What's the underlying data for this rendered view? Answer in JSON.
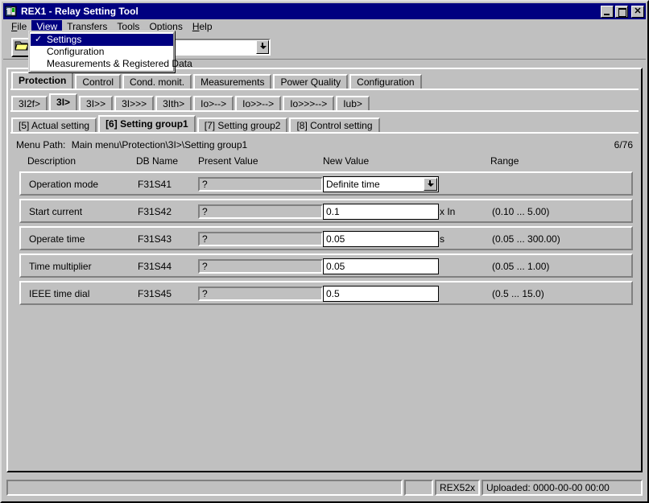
{
  "window": {
    "title": "REX1 - Relay Setting Tool",
    "icon": "relay-device-icon",
    "buttons": {
      "minimize": "_",
      "maximize": "□",
      "close": "✕"
    },
    "colors": {
      "titlebar": "#000080",
      "face": "#c0c0c0",
      "highlight": "#ffffff",
      "shadow": "#808080",
      "menu_highlight": "#000080"
    }
  },
  "menubar": {
    "items": [
      {
        "label": "File",
        "accel": "F",
        "open": false
      },
      {
        "label": "View",
        "accel": "V",
        "open": true
      },
      {
        "label": "Transfers",
        "accel": "T",
        "open": false
      },
      {
        "label": "Tools",
        "accel": "T",
        "open": false
      },
      {
        "label": "Options",
        "accel": "O",
        "open": false
      },
      {
        "label": "Help",
        "accel": "H",
        "open": false
      }
    ]
  },
  "dropdown": {
    "owner": "View",
    "items": [
      {
        "label": "Settings",
        "checked": true,
        "selected": true
      },
      {
        "label": "Configuration",
        "checked": false,
        "selected": false
      },
      {
        "label": "Measurements & Registered Data",
        "checked": false,
        "selected": false
      }
    ]
  },
  "toolbar": {
    "open_button_icon": "open-folder-icon",
    "combo_value": "",
    "combo_placeholder": "",
    "combo_arrow_icon": "dropdown-arrow-icon"
  },
  "tabs_primary": [
    {
      "label": "Protection",
      "active": true
    },
    {
      "label": "Control",
      "active": false
    },
    {
      "label": "Cond. monit.",
      "active": false
    },
    {
      "label": "Measurements",
      "active": false
    },
    {
      "label": "Power Quality",
      "active": false
    },
    {
      "label": "Configuration",
      "active": false
    }
  ],
  "tabs_secondary": [
    {
      "label": "3I2f>",
      "active": false
    },
    {
      "label": "3I>",
      "active": true
    },
    {
      "label": "3I>>",
      "active": false
    },
    {
      "label": "3I>>>",
      "active": false
    },
    {
      "label": "3Ith>",
      "active": false
    },
    {
      "label": "Io>-->",
      "active": false
    },
    {
      "label": "Io>>-->",
      "active": false
    },
    {
      "label": "Io>>>-->",
      "active": false
    },
    {
      "label": "Iub>",
      "active": false
    }
  ],
  "tabs_tertiary": [
    {
      "label": "[5] Actual setting",
      "active": false
    },
    {
      "label": "[6] Setting group1",
      "active": true
    },
    {
      "label": "[7] Setting group2",
      "active": false
    },
    {
      "label": "[8] Control setting",
      "active": false
    }
  ],
  "menu_path": {
    "label": "Menu Path:",
    "value": "Main menu\\Protection\\3I>\\Setting group1",
    "counter": "6/76"
  },
  "columns": {
    "description": "Description",
    "db_name": "DB Name",
    "present_value": "Present Value",
    "new_value": "New Value",
    "range": "Range"
  },
  "rows": [
    {
      "description": "Operation mode",
      "db_name": "F31S41",
      "present_value": "?",
      "new_value": "Definite time",
      "new_value_type": "combo",
      "unit": "",
      "range": ""
    },
    {
      "description": "Start current",
      "db_name": "F31S42",
      "present_value": "?",
      "new_value": "0.1",
      "new_value_type": "text",
      "unit": "x In",
      "range": "(0.10 ... 5.00)"
    },
    {
      "description": "Operate time",
      "db_name": "F31S43",
      "present_value": "?",
      "new_value": "0.05",
      "new_value_type": "text",
      "unit": "s",
      "range": "(0.05 ... 300.00)"
    },
    {
      "description": "Time multiplier",
      "db_name": "F31S44",
      "present_value": "?",
      "new_value": "0.05",
      "new_value_type": "text",
      "unit": "",
      "range": "(0.05 ... 1.00)"
    },
    {
      "description": "IEEE time dial",
      "db_name": "F31S45",
      "present_value": "?",
      "new_value": "0.5",
      "new_value_type": "text",
      "unit": "",
      "range": "(0.5 ... 15.0)"
    }
  ],
  "statusbar": {
    "main": "",
    "blank": "",
    "device": "REX52x",
    "uploaded": "Uploaded: 0000-00-00 00:00"
  }
}
